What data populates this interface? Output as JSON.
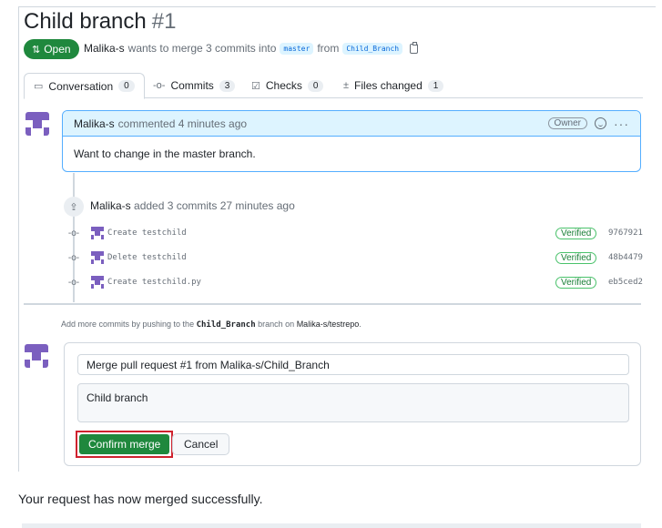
{
  "pr": {
    "title": "Child branch",
    "number": "#1",
    "state": "Open",
    "author": "Malika-s",
    "merge_text": "wants to merge 3 commits into",
    "base_branch": "master",
    "from_text": "from",
    "head_branch": "Child_Branch"
  },
  "tabs": [
    {
      "label": "Conversation",
      "count": "0",
      "icon": "conversation-icon"
    },
    {
      "label": "Commits",
      "count": "3",
      "icon": "commit-icon"
    },
    {
      "label": "Checks",
      "count": "0",
      "icon": "checklist-icon"
    },
    {
      "label": "Files changed",
      "count": "1",
      "icon": "diff-icon"
    }
  ],
  "comment": {
    "author": "Malika-s",
    "meta": "commented 4 minutes ago",
    "badge": "Owner",
    "body": "Want to change in the master branch."
  },
  "push_event": {
    "author": "Malika-s",
    "text": "added 3 commits 27 minutes ago"
  },
  "commits": [
    {
      "message": "Create testchild",
      "verified": "Verified",
      "sha": "9767921"
    },
    {
      "message": "Delete testchild",
      "verified": "Verified",
      "sha": "48b4479"
    },
    {
      "message": "Create testchild.py",
      "verified": "Verified",
      "sha": "eb5ced2"
    }
  ],
  "hint": {
    "prefix": "Add more commits by pushing to the",
    "branch": "Child_Branch",
    "middle": "branch on",
    "repo": "Malika-s/testrepo",
    "suffix": "."
  },
  "merge_form": {
    "title_value": "Merge pull request #1 from Malika-s/Child_Branch",
    "body_value": "Child branch",
    "confirm_label": "Confirm merge",
    "cancel_label": "Cancel"
  },
  "success_message": "Your request has now merged successfully.",
  "colors": {
    "open_green": "#1f883d",
    "highlight_red": "#cf222e",
    "comment_header": "#ddf4ff",
    "avatar_purple": "#7b5fbf"
  }
}
